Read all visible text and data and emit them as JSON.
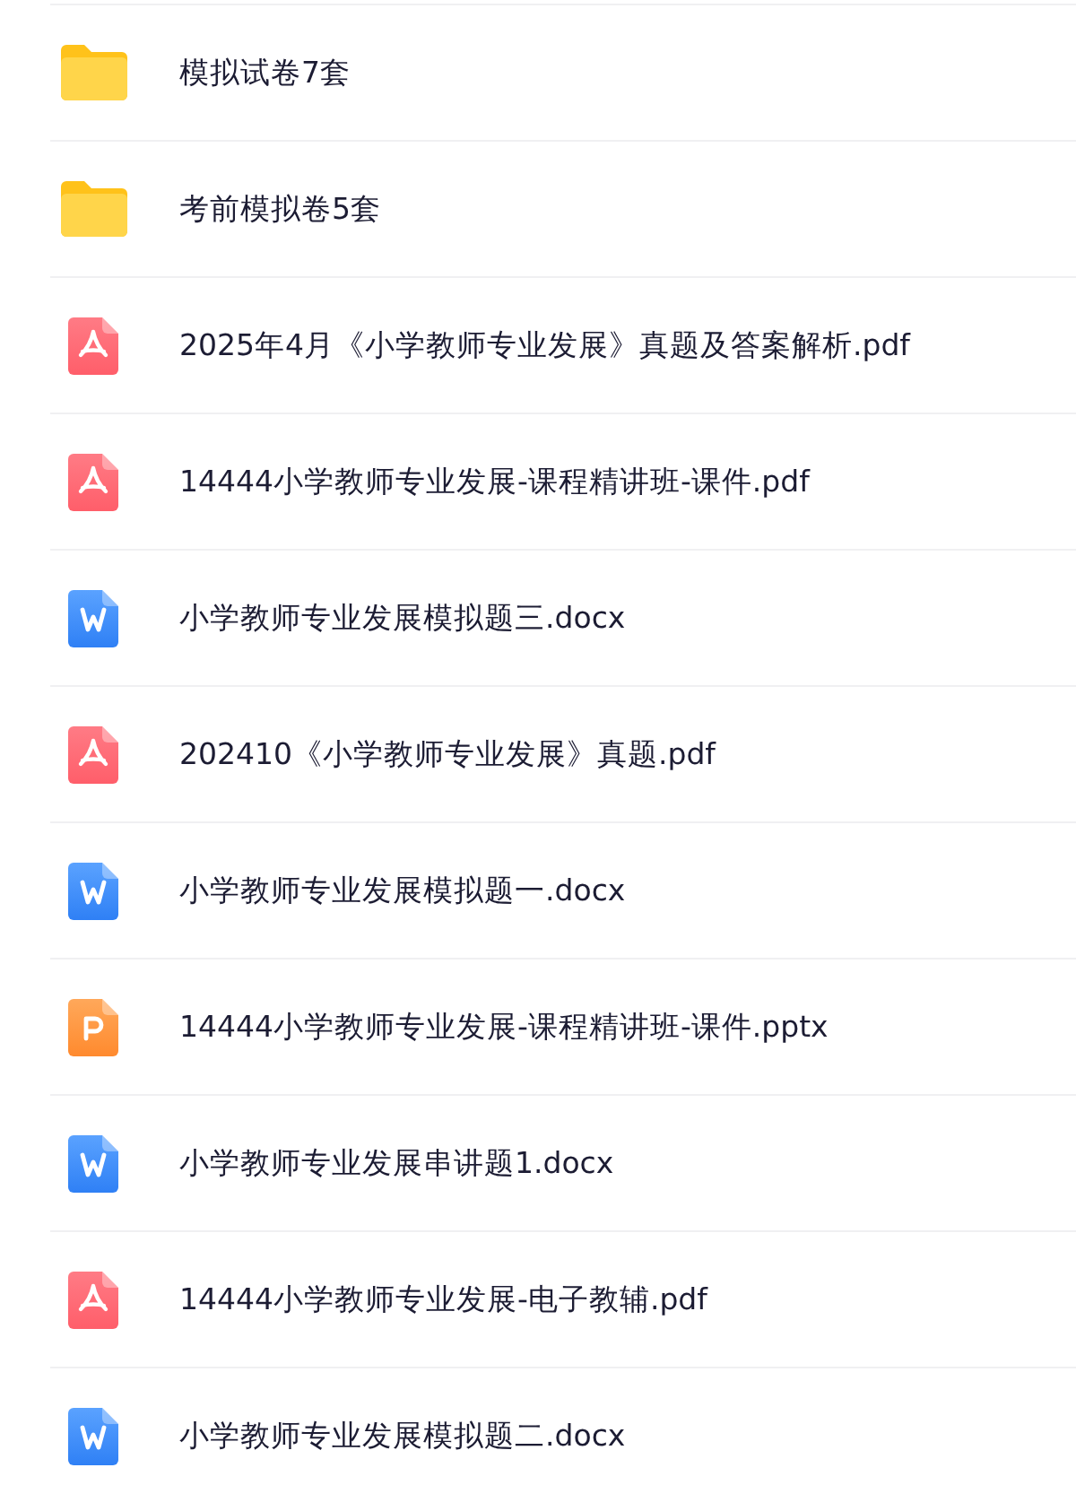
{
  "files": [
    {
      "kind": "folder",
      "name": "模拟试卷7套"
    },
    {
      "kind": "folder",
      "name": "考前模拟卷5套"
    },
    {
      "kind": "pdf",
      "name": "2025年4月《小学教师专业发展》真题及答案解析.pdf"
    },
    {
      "kind": "pdf",
      "name": "14444小学教师专业发展-课程精讲班-课件.pdf"
    },
    {
      "kind": "word",
      "name": "小学教师专业发展模拟题三.docx"
    },
    {
      "kind": "pdf",
      "name": "202410《小学教师专业发展》真题.pdf"
    },
    {
      "kind": "word",
      "name": "小学教师专业发展模拟题一.docx"
    },
    {
      "kind": "slides",
      "name": "14444小学教师专业发展-课程精讲班-课件.pptx"
    },
    {
      "kind": "word",
      "name": "小学教师专业发展串讲题1.docx"
    },
    {
      "kind": "pdf",
      "name": "14444小学教师专业发展-电子教辅.pdf"
    },
    {
      "kind": "word",
      "name": "小学教师专业发展模拟题二.docx"
    }
  ]
}
